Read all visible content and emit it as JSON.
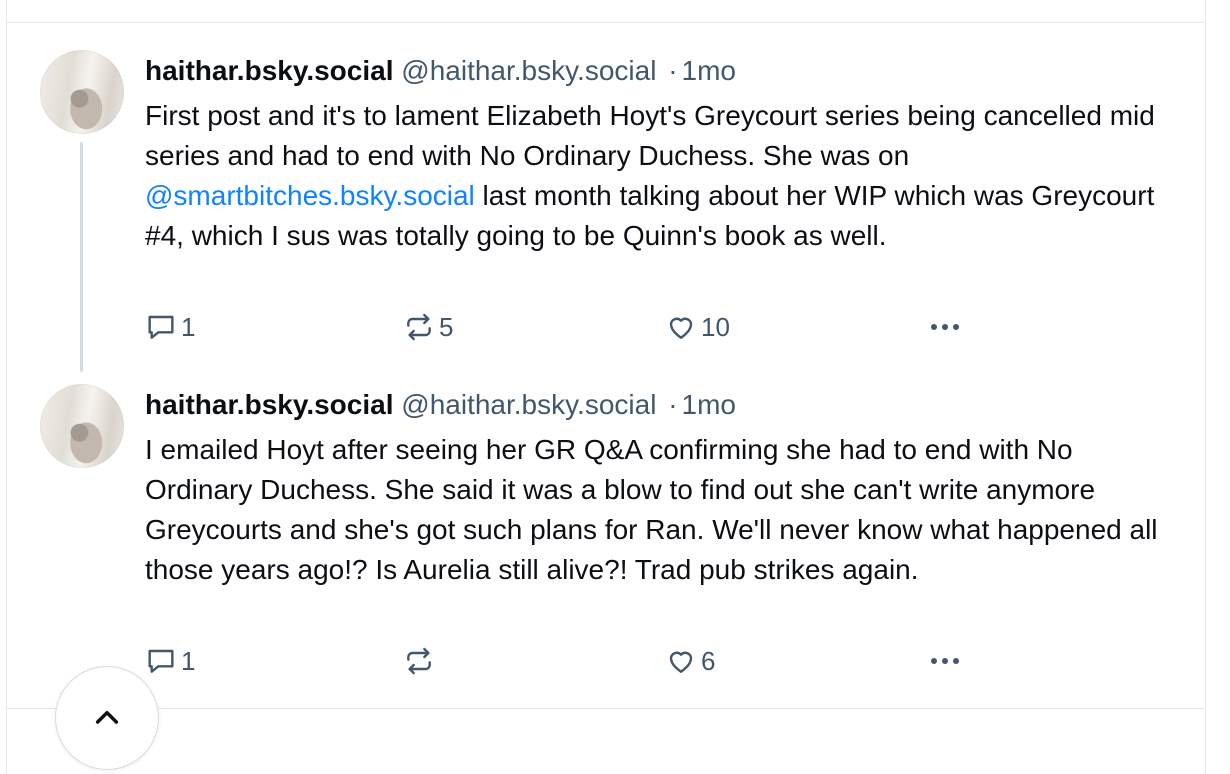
{
  "posts": [
    {
      "display_name": "haithar.bsky.social",
      "handle": "@haithar.bsky.social",
      "separator": "·",
      "timestamp": "1mo",
      "text_before_mention": "First post and it's to lament Elizabeth Hoyt's Greycourt series being cancelled mid series and had to end with No Ordinary Duchess. She was on ",
      "mention": "@smartbitches.bsky.social",
      "text_after_mention": " last month talking about her WIP which was Greycourt #4, which I sus was totally going to be Quinn's book as well.",
      "reply_count": "1",
      "repost_count": "5",
      "like_count": "10"
    },
    {
      "display_name": "haithar.bsky.social",
      "handle": "@haithar.bsky.social",
      "separator": "·",
      "timestamp": "1mo",
      "text": "I emailed Hoyt after seeing her GR Q&A confirming she had to end with No Ordinary Duchess. She said it was a blow to find out she can't write anymore Greycourts and she's got such plans for Ran. We'll never know what happened all those years ago!? Is Aurelia still alive?! Trad pub strikes again.",
      "reply_count": "1",
      "repost_count": "",
      "like_count": "6"
    }
  ],
  "icons": {
    "reply": "speech-bubble-icon",
    "repost": "repost-arrows-icon",
    "like": "heart-icon",
    "more": "ellipsis-icon",
    "scroll_top": "chevron-up-icon"
  },
  "colors": {
    "link": "#1083fe",
    "muted": "#42576c",
    "divider": "#e3e8ed"
  }
}
